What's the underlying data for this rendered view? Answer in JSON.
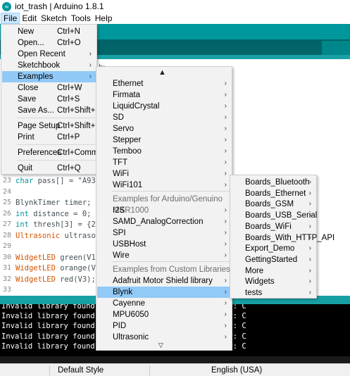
{
  "window": {
    "title": "iot_trash | Arduino 1.8.1",
    "app_icon": "arduino-icon"
  },
  "menubar": [
    "File",
    "Edit",
    "Sketch",
    "Tools",
    "Help"
  ],
  "file_menu": [
    {
      "label": "New",
      "shortcut": "Ctrl+N"
    },
    {
      "label": "Open...",
      "shortcut": "Ctrl+O"
    },
    {
      "label": "Open Recent",
      "shortcut": "",
      "submenu": true
    },
    {
      "label": "Sketchbook",
      "shortcut": "",
      "submenu": true
    },
    {
      "label": "Examples",
      "shortcut": "",
      "submenu": true,
      "highlighted": true
    },
    {
      "label": "Close",
      "shortcut": "Ctrl+W"
    },
    {
      "label": "Save",
      "shortcut": "Ctrl+S"
    },
    {
      "label": "Save As...",
      "shortcut": "Ctrl+Shift+S"
    },
    {
      "label": "Page Setup",
      "shortcut": "Ctrl+Shift+P"
    },
    {
      "label": "Print",
      "shortcut": "Ctrl+P"
    },
    {
      "label": "Preferences",
      "shortcut": "Ctrl+Comma"
    },
    {
      "label": "Quit",
      "shortcut": "Ctrl+Q"
    }
  ],
  "examples_menu": {
    "scroll_up": "▲",
    "scroll_down": "▽",
    "items": [
      {
        "label": "Ethernet",
        "submenu": true
      },
      {
        "label": "Firmata",
        "submenu": true
      },
      {
        "label": "LiquidCrystal",
        "submenu": true
      },
      {
        "label": "SD",
        "submenu": true
      },
      {
        "label": "Servo",
        "submenu": true
      },
      {
        "label": "Stepper",
        "submenu": true
      },
      {
        "label": "Temboo",
        "submenu": true
      },
      {
        "label": "TFT",
        "submenu": true
      },
      {
        "label": "WiFi",
        "submenu": true
      },
      {
        "label": "WiFi101",
        "submenu": true
      },
      {
        "label": "Examples for Arduino/Genuino MKR1000",
        "header": true
      },
      {
        "label": "I2S",
        "submenu": true
      },
      {
        "label": "SAMD_AnalogCorrection",
        "submenu": true
      },
      {
        "label": "SPI",
        "submenu": true
      },
      {
        "label": "USBHost",
        "submenu": true
      },
      {
        "label": "Wire",
        "submenu": true
      },
      {
        "label": "Examples from Custom Libraries",
        "header": true
      },
      {
        "label": "Adafruit Motor Shield library",
        "submenu": true
      },
      {
        "label": "Blynk",
        "submenu": true,
        "highlighted": true
      },
      {
        "label": "Cayenne",
        "submenu": true
      },
      {
        "label": "MPU6050",
        "submenu": true
      },
      {
        "label": "PID",
        "submenu": true
      },
      {
        "label": "Ultrasonic",
        "submenu": true
      }
    ]
  },
  "blynk_menu": [
    "Boards_Bluetooth",
    "Boards_Ethernet",
    "Boards_GSM",
    "Boards_USB_Serial",
    "Boards_WiFi",
    "Boards_With_HTTP_API",
    "Export_Demo",
    "GettingStarted",
    "More",
    "Widgets",
    "tests"
  ],
  "editor": {
    "cutoff_text": "h>",
    "lines": [
      {
        "n": "23",
        "parts": [
          [
            "kw",
            "char"
          ],
          [
            "plain",
            " pass[] = \"A93rt"
          ]
        ]
      },
      {
        "n": "24",
        "parts": []
      },
      {
        "n": "25",
        "parts": [
          [
            "plain",
            "BlynkTimer timer;"
          ]
        ]
      },
      {
        "n": "26",
        "parts": [
          [
            "kw",
            "int"
          ],
          [
            "plain",
            " distance = 0;"
          ]
        ]
      },
      {
        "n": "27",
        "parts": [
          [
            "kw",
            "int"
          ],
          [
            "plain",
            " thresh[3] = {25,"
          ]
        ]
      },
      {
        "n": "28",
        "parts": [
          [
            "cls",
            "Ultrasonic"
          ],
          [
            "plain",
            " ultrasoni"
          ]
        ]
      },
      {
        "n": "29",
        "parts": []
      },
      {
        "n": "30",
        "parts": [
          [
            "cls",
            "WidgetLED"
          ],
          [
            "plain",
            " green(V1);"
          ]
        ]
      },
      {
        "n": "31",
        "parts": [
          [
            "cls",
            "WidgetLED"
          ],
          [
            "plain",
            " orange(V2)"
          ]
        ]
      },
      {
        "n": "32",
        "parts": [
          [
            "cls",
            "WidgetLED"
          ],
          [
            "plain",
            " red(V3);"
          ]
        ]
      },
      {
        "n": "33",
        "parts": []
      },
      {
        "n": "34",
        "parts": []
      },
      {
        "n": "35",
        "parts": []
      }
    ]
  },
  "console": {
    "lines": [
      "Invalid library found in \\libraries\\i2cdevlib-master: C",
      "Invalid library found in \\libraries\\i2cdevlib-master: C",
      "Invalid library found in \\libraries\\i2cdevlib-master: C",
      "Invalid library found in \\libraries\\i2cdevlib-master: C",
      "Invalid library found in \\libraries\\i2cdevlib-master: C"
    ]
  },
  "statusbar": {
    "style": "Default Style",
    "language": "English (USA)"
  },
  "colors": {
    "teal": "#00979c",
    "dark_teal": "#006468",
    "highlight": "#91c9f7"
  }
}
